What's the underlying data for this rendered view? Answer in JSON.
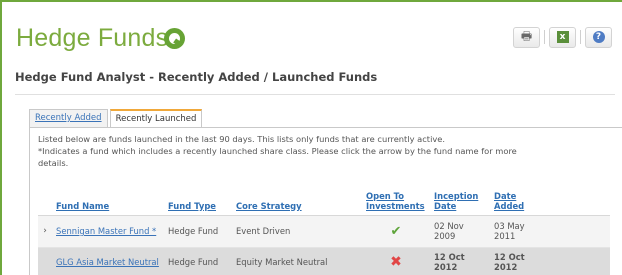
{
  "app": {
    "title": "Hedge Funds"
  },
  "toolbar": {
    "print_label": "🖶",
    "excel_label": "x",
    "help_label": "?"
  },
  "page": {
    "subtitle": "Hedge Fund Analyst - Recently Added / Launched Funds"
  },
  "tabs": [
    {
      "label": "Recently Added",
      "active": false
    },
    {
      "label": "Recently Launched",
      "active": true
    }
  ],
  "intro": {
    "line1": "Listed below are funds launched in the last 90 days. This lists only funds that are currently active.",
    "line2": "*Indicates a fund which includes a recently launched share class. Please click the arrow by the fund name for more",
    "line3": "details."
  },
  "table": {
    "headers": {
      "fund_name": "Fund Name",
      "fund_type": "Fund Type",
      "core_strategy": "Core Strategy",
      "open_to_investments": "Open To Investments",
      "inception_date": "Inception Date",
      "date_added": "Date Added"
    },
    "rows": [
      {
        "expander": "›",
        "fund_name": "Sennigan Master Fund *",
        "fund_type": "Hedge Fund",
        "core_strategy": "Event Driven",
        "open": "✔",
        "inception_date": "02 Nov 2009",
        "date_added": "03 May 2011"
      },
      {
        "expander": "",
        "fund_name": "GLG Asia Market Neutral",
        "fund_type": "Hedge Fund",
        "core_strategy": "Equity Market Neutral",
        "open": "✖",
        "inception_date": "12 Oct 2012",
        "date_added": "12 Oct 2012"
      }
    ]
  },
  "colors": {
    "brand": "#7cab3e",
    "link": "#3a73b8",
    "tab_accent": "#f0a83a",
    "tick": "#5ea43a",
    "cross": "#e14545"
  }
}
